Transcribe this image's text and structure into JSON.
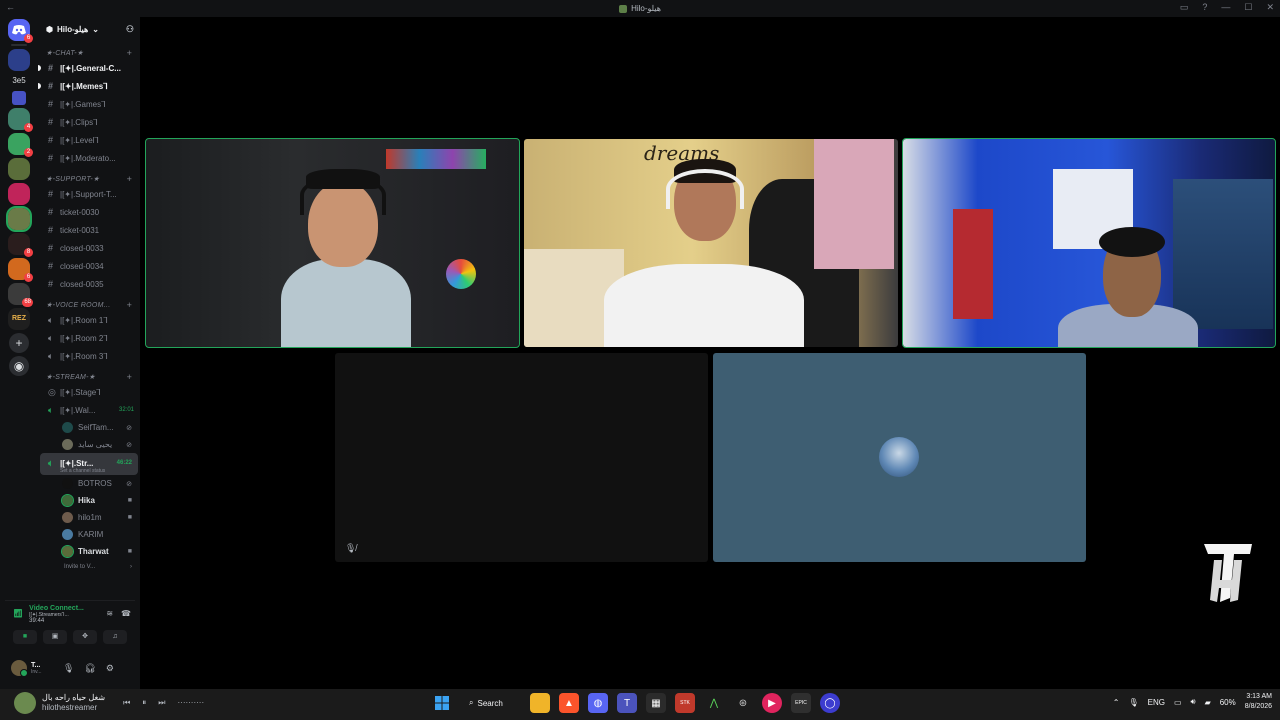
{
  "window": {
    "title": "Hilo-هيلو",
    "back_glyph": "←"
  },
  "rail": {
    "badges": [
      "6",
      "4",
      "2",
      "8",
      "6",
      "68"
    ],
    "text_server": "3e5"
  },
  "server": {
    "name": "Hilo-هيلو"
  },
  "categories": {
    "chat": "★-CHAT-★",
    "support": "★-SUPPORT-★",
    "voice": "★-VOICE ROOM...",
    "stream": "★-STREAM-★"
  },
  "channels": {
    "general": "|[✦|.General-C...",
    "memes": "|[✦|.Memes⅂",
    "games": "|[✦|.Games⅂",
    "clips": "|[✦|.Clips⅂",
    "level": "|[✦|.Level⅂",
    "moderato": "|[✦|.Moderato...",
    "support_t": "|[✦|.Support-T...",
    "ticket_0030": "ticket-0030",
    "ticket_0031": "ticket-0031",
    "closed_0033": "closed-0033",
    "closed_0034": "closed-0034",
    "closed_0035": "closed-0035",
    "room1": "|[✦|.Room 1⅂",
    "room2": "|[✦|.Room 2⅂",
    "room3": "|[✦|.Room 3⅂",
    "stage": "|[✦|.Stage⅂",
    "wal": "|[✦|.Wal...",
    "wal_time": "32:01",
    "str": "|[✦|.Str...",
    "str_time": "46:22",
    "str_status": "Set a channel status"
  },
  "wal_members": [
    "SeifTam...",
    "يحيى سايد"
  ],
  "str_members": [
    "BOTROS",
    "Hika",
    "hilo1m",
    "KARIM",
    "Tharwat"
  ],
  "invite_text": "Invite to V...",
  "voice_panel": {
    "title": "Video Connect...",
    "channel": "|[✦|.Streamers⅂...",
    "time": "39:44"
  },
  "user_panel": {
    "name": "T...",
    "status": "Inv..."
  },
  "tile2_text": "dreams",
  "taskbar": {
    "media_title": "شغل حياه راحه بال",
    "media_sub": "hilothestreamer",
    "search": "Search",
    "lang": "ENG",
    "battery": "60%",
    "time": "3:13 AM",
    "date": "8/8/2026"
  }
}
